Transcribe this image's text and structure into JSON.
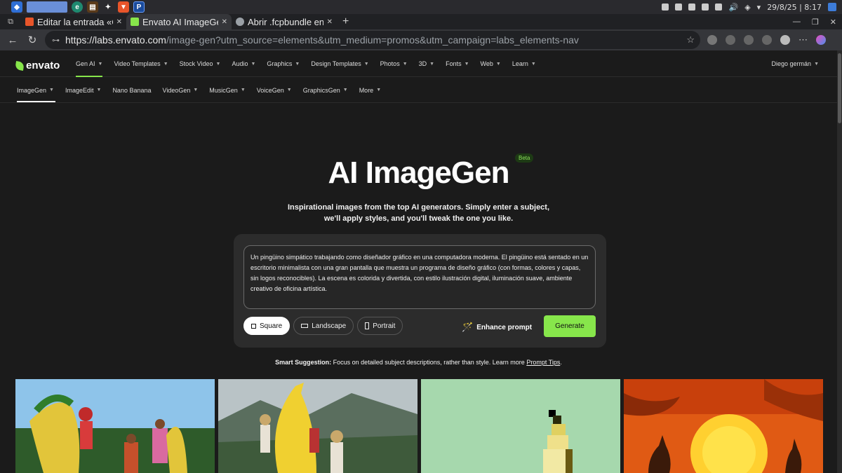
{
  "taskbar": {
    "datetime": "29/8/25 | 8:17"
  },
  "tabs": [
    {
      "label": "Editar la entrada «C",
      "favicon_color": "#e8552a"
    },
    {
      "label": "Envato AI ImageGen",
      "favicon_color": "#87e64b"
    },
    {
      "label": "Abrir .fcpbundle en",
      "favicon_color": "#9aa0a6"
    }
  ],
  "address": {
    "host": "https://labs.envato.com",
    "path": "/image-gen?utm_source=elements&utm_medium=promos&utm_campaign=labs_elements-nav"
  },
  "site": {
    "logo": "envato",
    "user": "Diego germán",
    "topnav": [
      "Gen AI",
      "Video Templates",
      "Stock Video",
      "Audio",
      "Graphics",
      "Design Templates",
      "Photos",
      "3D",
      "Fonts",
      "Web",
      "Learn"
    ],
    "subnav": [
      "ImageGen",
      "ImageEdit",
      "Nano Banana",
      "VideoGen",
      "MusicGen",
      "VoiceGen",
      "GraphicsGen",
      "More"
    ]
  },
  "hero": {
    "title": "AI ImageGen",
    "badge": "Beta",
    "subtitle_line1": "Inspirational images from the top AI generators. Simply enter a subject,",
    "subtitle_line2": "we'll apply styles, and you'll tweak the one you like."
  },
  "prompt": {
    "text": "Un pingüino simpático trabajando como diseñador gráfico en una computadora moderna. El pingüino está sentado en un escritorio minimalista con una gran pantalla que muestra un programa de diseño gráfico (con formas, colores y capas, sin logos reconocibles). La escena es colorida y divertida, con estilo ilustración digital, iluminación suave, ambiente creativo de oficina artística.",
    "aspect_square": "Square",
    "aspect_landscape": "Landscape",
    "aspect_portrait": "Portrait",
    "enhance": "Enhance prompt",
    "generate": "Generate"
  },
  "suggestion": {
    "lead": "Smart Suggestion:",
    "text": " Focus on detailed subject descriptions, rather than style. Learn more ",
    "link": "Prompt Tips",
    "end": "."
  },
  "colors": {
    "accent": "#87e64b",
    "background": "#1b1b1b",
    "card": "#2c2c2c"
  }
}
